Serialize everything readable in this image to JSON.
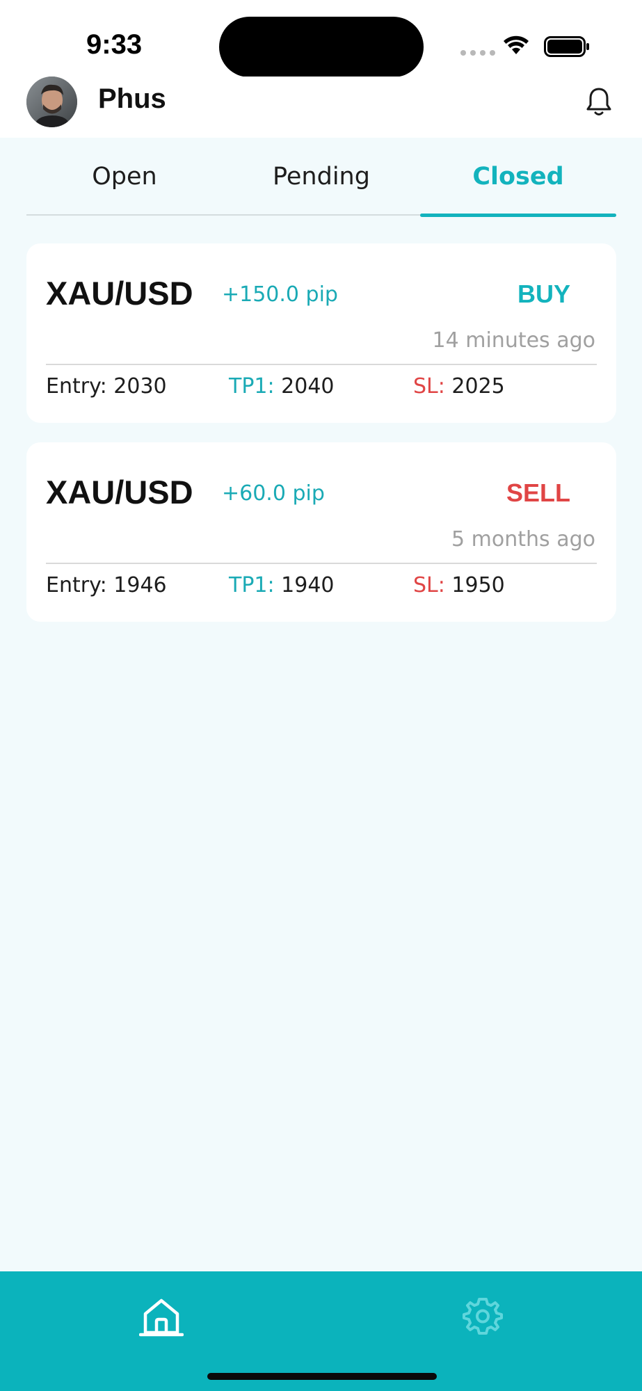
{
  "status_bar": {
    "time": "9:33"
  },
  "header": {
    "username": "Phus"
  },
  "tabs": [
    {
      "label": "Open"
    },
    {
      "label": "Pending"
    },
    {
      "label": "Closed"
    }
  ],
  "active_tab": "Closed",
  "trades": [
    {
      "pair": "XAU/USD",
      "pips": "+150.0 pip",
      "side": "BUY",
      "side_color": "#13b3bd",
      "time_ago": "14 minutes ago",
      "entry_label": "Entry:",
      "entry_value": "2030",
      "tp_label": "TP1:",
      "tp_value": "2040",
      "sl_label": "SL:",
      "sl_value": "2025"
    },
    {
      "pair": "XAU/USD",
      "pips": "+60.0 pip",
      "side": "SELL",
      "side_color": "#e04545",
      "time_ago": "5 months ago",
      "entry_label": "Entry:",
      "entry_value": "1946",
      "tp_label": "TP1:",
      "tp_value": "1940",
      "sl_label": "SL:",
      "sl_value": "1950"
    }
  ],
  "colors": {
    "accent": "#13b3bd",
    "sell": "#e04545",
    "nav_bg": "#0bb3bc",
    "page_bg": "#f2fafc"
  },
  "bottom_nav": {
    "items": [
      {
        "icon": "home-icon",
        "active": true
      },
      {
        "icon": "gear-icon",
        "active": false
      }
    ]
  }
}
